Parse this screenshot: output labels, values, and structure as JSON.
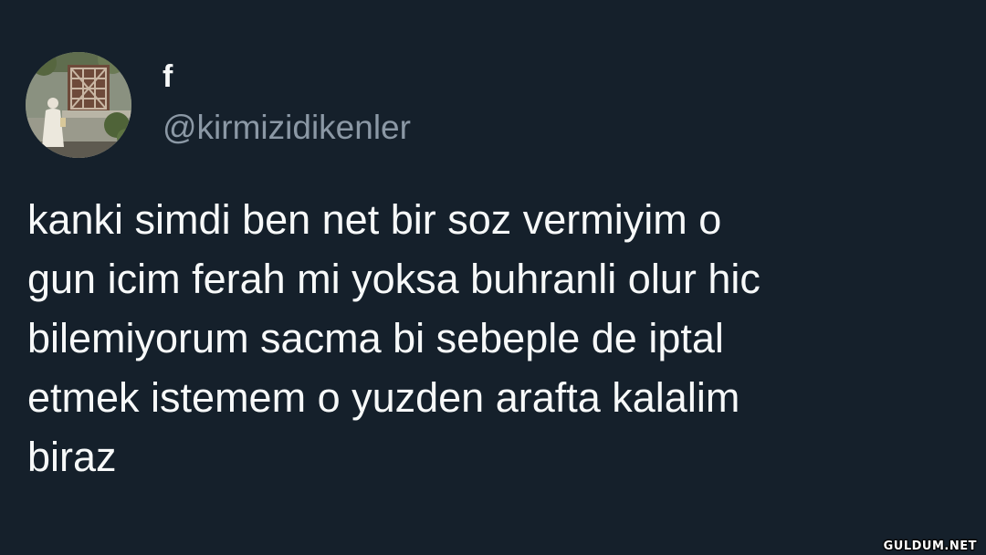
{
  "author": {
    "display_name": "f",
    "handle": "@kirmizidikenler",
    "avatar_icon": "profile-photo"
  },
  "tweet": {
    "lines": [
      "kanki simdi ben net bir soz vermiyim o",
      "gun icim ferah mi yoksa buhranli olur hic",
      "bilemiyorum sacma bi sebeple de iptal",
      "etmek istemem o yuzden arafta kalalim",
      "biraz"
    ]
  },
  "watermark": "GULDUM.NET",
  "colors": {
    "background": "#15202b",
    "text": "#f7f9f9",
    "secondary_text": "#8b98a5"
  }
}
